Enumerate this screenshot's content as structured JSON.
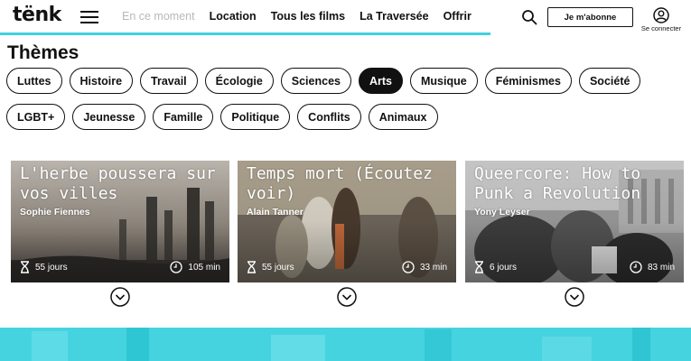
{
  "header": {
    "logo": "tënk",
    "nav": [
      "En ce moment",
      "Location",
      "Tous les films",
      "La Traversée",
      "Offrir"
    ],
    "subscribe_label": "Je m'abonne",
    "login_label": "Se connecter"
  },
  "themes": {
    "title": "Thèmes",
    "row1": [
      "Luttes",
      "Histoire",
      "Travail",
      "Écologie",
      "Sciences",
      "Arts",
      "Musique",
      "Féminismes",
      "Société"
    ],
    "row2": [
      "LGBT+",
      "Jeunesse",
      "Famille",
      "Politique",
      "Conflits",
      "Animaux"
    ],
    "active": "Arts"
  },
  "films": [
    {
      "title": "L'herbe poussera sur vos villes",
      "author": "Sophie Fiennes",
      "days": "55 jours",
      "duration": "105 min"
    },
    {
      "title": "Temps mort (Écoutez voir)",
      "author": "Alain Tanner",
      "days": "55 jours",
      "duration": "33 min"
    },
    {
      "title": "Queercore: How to Punk a Revolution",
      "author": "Yony Leyser",
      "days": "6 jours",
      "duration": "83 min"
    }
  ],
  "colors": {
    "accent": "#3fd2e0",
    "banner": "#45d3df"
  }
}
